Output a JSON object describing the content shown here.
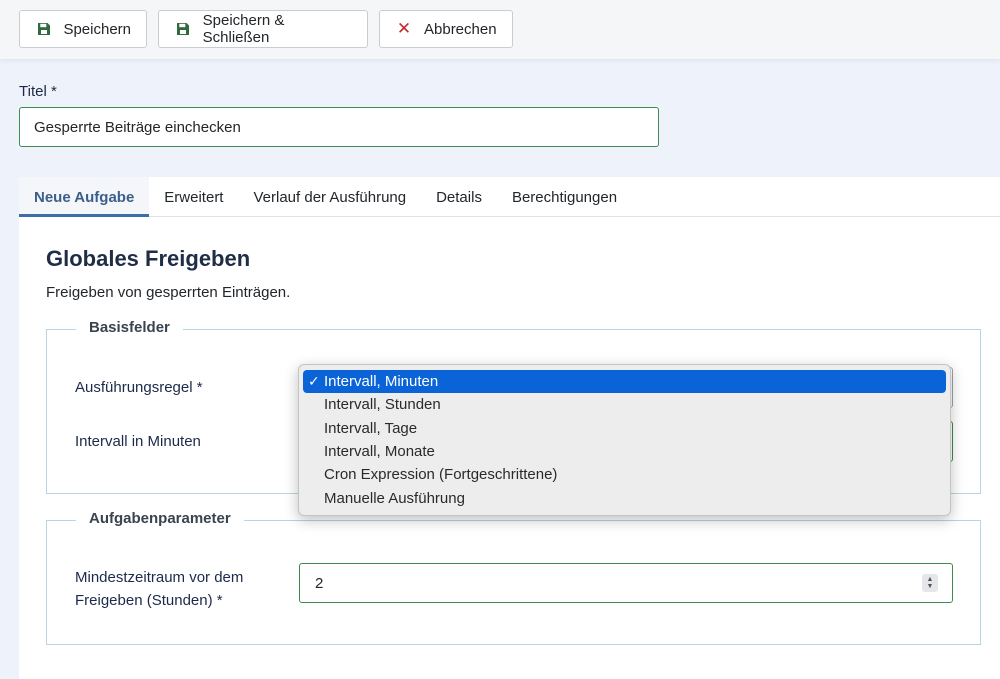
{
  "toolbar": {
    "save_label": "Speichern",
    "save_close_label": "Speichern & Schließen",
    "cancel_label": "Abbrechen",
    "cancel_icon": "✕"
  },
  "form": {
    "title_label": "Titel *",
    "title_value": "Gesperrte Beiträge einchecken"
  },
  "tabs": [
    {
      "label": "Neue Aufgabe",
      "active": true
    },
    {
      "label": "Erweitert"
    },
    {
      "label": "Verlauf der Ausführung"
    },
    {
      "label": "Details"
    },
    {
      "label": "Berechtigungen"
    }
  ],
  "task": {
    "heading": "Globales Freigeben",
    "description": "Freigeben von gesperrten Einträgen."
  },
  "basic_fields": {
    "legend": "Basisfelder",
    "execution_rule_label": "Ausführungsregel *",
    "interval_label": "Intervall in Minuten"
  },
  "task_params": {
    "legend": "Aufgabenparameter",
    "min_period_label_line1": "Mindestzeitraum vor dem",
    "min_period_label_line2": "Freigeben (Stunden) *",
    "min_period_value": "2"
  },
  "dropdown": {
    "check_mark": "✓",
    "options": [
      {
        "label": "Intervall, Minuten",
        "selected": true
      },
      {
        "label": "Intervall, Stunden"
      },
      {
        "label": "Intervall, Tage"
      },
      {
        "label": "Intervall, Monate"
      },
      {
        "label": "Cron Expression (Fortgeschrittene)"
      },
      {
        "label": "Manuelle Ausführung"
      }
    ]
  },
  "colors": {
    "accent": "#3b6fa8",
    "success_border": "#3e8a4f",
    "danger": "#c52827",
    "selection": "#0a64d8"
  }
}
